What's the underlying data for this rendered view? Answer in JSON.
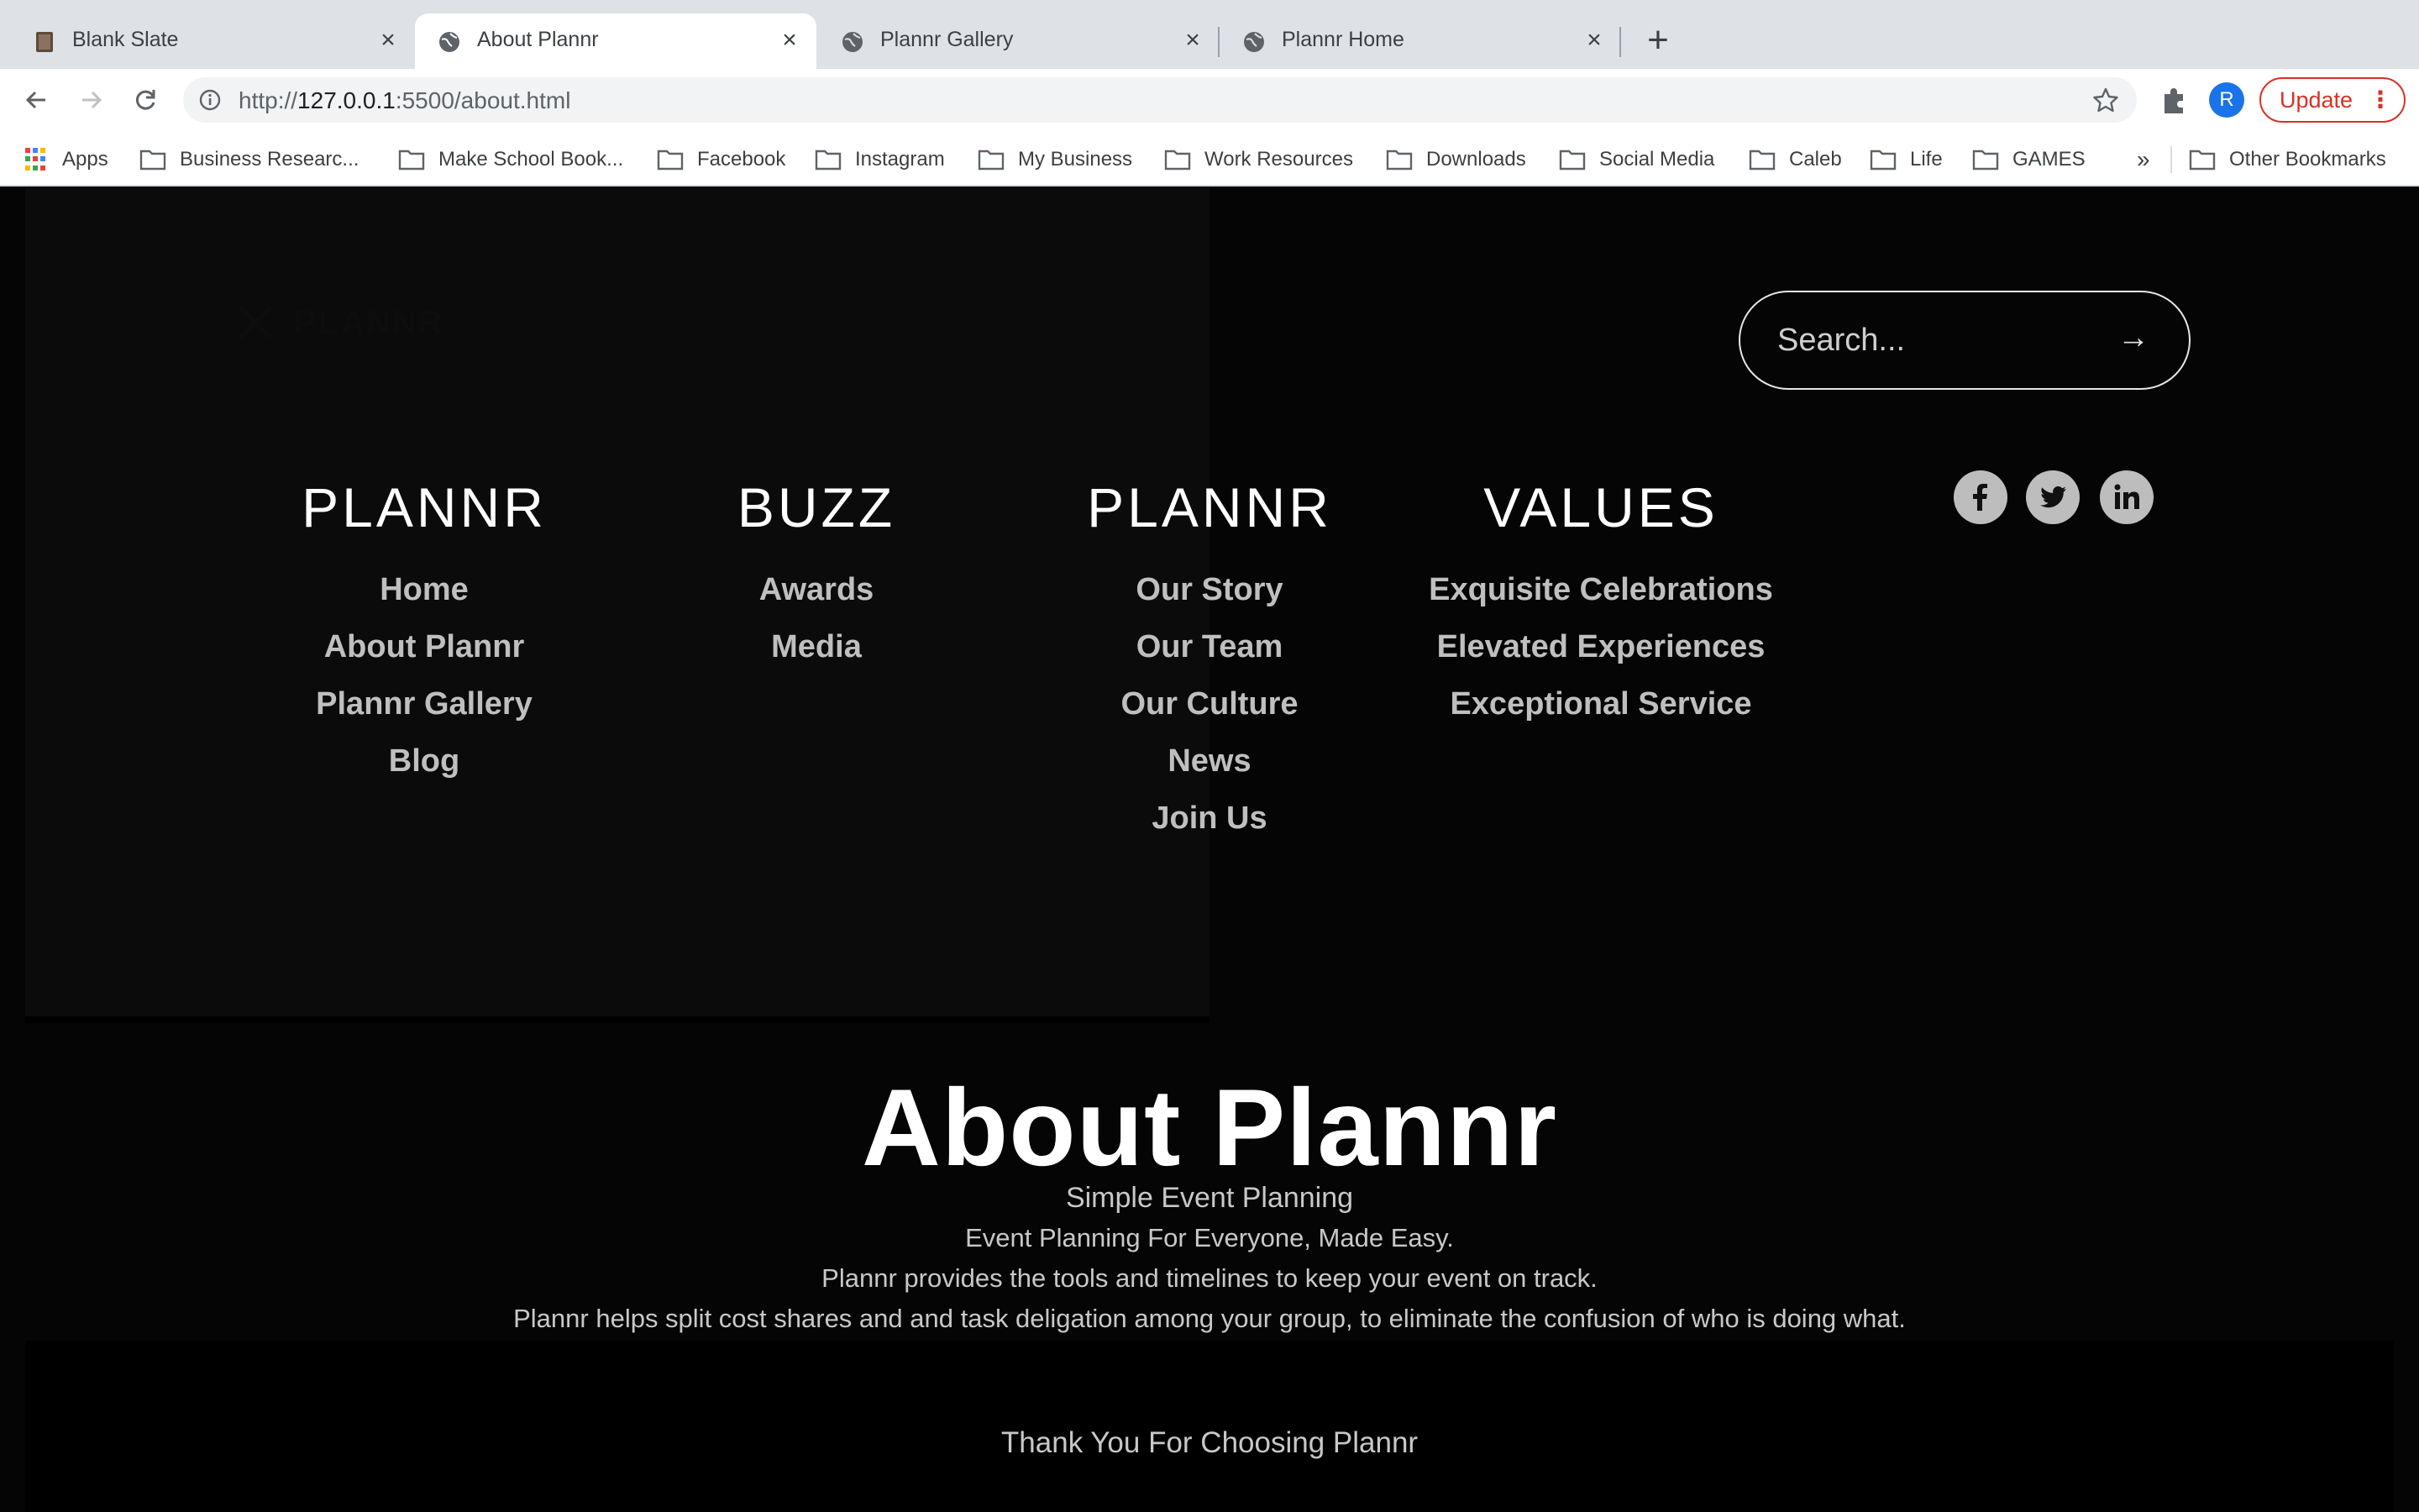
{
  "browser": {
    "tabs": [
      {
        "title": "Blank Slate",
        "active": false,
        "favicon": "book-icon"
      },
      {
        "title": "About Plannr",
        "active": true,
        "favicon": "globe-icon"
      },
      {
        "title": "Plannr Gallery",
        "active": false,
        "favicon": "globe-icon"
      },
      {
        "title": "Plannr Home",
        "active": false,
        "favicon": "globe-icon"
      }
    ],
    "new_tab": "+",
    "url_prefix": "http://",
    "url_host": "127.0.0.1",
    "url_rest": ":5500/about.html",
    "profile_initial": "R",
    "update_label": "Update",
    "bookmarks": [
      "Apps",
      "Business Researc...",
      "Make School Book...",
      "Facebook",
      "Instagram",
      "My Business",
      "Work Resources",
      "Downloads",
      "Social Media",
      "Caleb",
      "Life",
      "GAMES"
    ],
    "bookmarks_overflow": "»",
    "other_bookmarks": "Other Bookmarks"
  },
  "page": {
    "logo_text": "PLANNR",
    "search": {
      "placeholder": "Search...",
      "submit_glyph": "→"
    },
    "columns": [
      {
        "heading": "PLANNR",
        "links": [
          "Home",
          "About Plannr",
          "Plannr Gallery",
          "Blog"
        ]
      },
      {
        "heading": "BUZZ",
        "links": [
          "Awards",
          "Media"
        ]
      },
      {
        "heading": "PLANNR",
        "links": [
          "Our Story",
          "Our Team",
          "Our Culture",
          "News",
          "Join Us"
        ]
      },
      {
        "heading": "VALUES",
        "links": [
          "Exquisite Celebrations",
          "Elevated Experiences",
          "Exceptional Service"
        ]
      }
    ],
    "social": [
      "facebook-icon",
      "twitter-icon",
      "linkedin-icon"
    ],
    "about": {
      "title": "About Plannr",
      "subtitle": "Simple Event Planning",
      "lines": [
        "Event Planning For Everyone, Made Easy.",
        "Plannr provides the tools and timelines to keep your event on track.",
        "Plannr helps split cost shares and and task deligation among your group, to eliminate the confusion of who is doing what."
      ]
    },
    "thanks": "Thank You For Choosing Plannr"
  },
  "colors": {
    "page_bg": "#050505",
    "menu_bg": "#0b0b0b",
    "link": "#bfbfbf",
    "heading": "#ffffff",
    "update": "#d93025",
    "avatar": "#1a73e8"
  }
}
